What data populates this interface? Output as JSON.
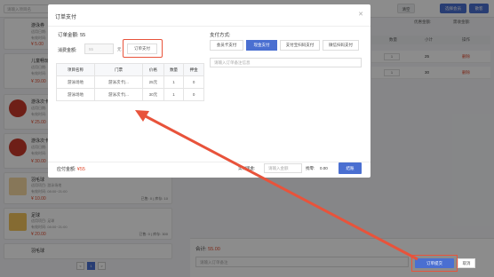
{
  "background": {
    "search_placeholder": "请输入项目名",
    "top_buttons": [
      "清空",
      "选择会员",
      "散客"
    ],
    "summary": {
      "discount_label": "优惠金额:",
      "received_label": "需收金额:"
    },
    "cards": [
      {
        "name": "游泳券",
        "line1": "适用日期:",
        "line2": "有效时间:",
        "price": "¥ 5.00"
      },
      {
        "name": "儿童畅玩",
        "line1": "适用日期:",
        "line2": "有效时间:",
        "price": "¥ 39.00"
      },
      {
        "name": "游泳次卡",
        "line1": "适用日期:",
        "line2": "有效时间:",
        "price": "¥ 25.00"
      },
      {
        "name": "游泳次卡",
        "line1": "适用日期:",
        "line2": "有效时间:",
        "price": "¥ 30.00"
      },
      {
        "name": "羽毛球",
        "line1": "适用项目: 游泳场地",
        "line2": "有效时间: 08:00~21:00",
        "price": "¥ 10.00",
        "meta": "已售: 0 | 库存: 10"
      },
      {
        "name": "足球",
        "line1": "适用项目: 足球",
        "line2": "有效时间: 08:00~21:00",
        "price": "¥ 20.00",
        "meta": "已售: 0 | 库存: 300"
      },
      {
        "name": "羽毛球",
        "line1": "",
        "line2": "",
        "price": ""
      }
    ],
    "cart_headers": [
      "数量",
      "小计",
      "操作"
    ],
    "cart_rows": [
      {
        "qty": "1",
        "subtotal": "25",
        "action": "删除"
      },
      {
        "qty": "1",
        "subtotal": "30",
        "action": "删除"
      }
    ],
    "total_label": "合计:",
    "total_value": "55.00",
    "remark_placeholder": "请输入订单备注",
    "submit_button": "订单提交",
    "cancel_button": "取消",
    "pager": [
      "<",
      "1",
      ">"
    ]
  },
  "modal": {
    "title": "订单支付",
    "close_icon": "close-icon",
    "amount_label": "订单金额:",
    "amount_value": "55",
    "consume_label": "消费金额:",
    "consume_placeholder": "55",
    "yuan": "元",
    "order_pay_button": "订单支付",
    "table": {
      "headers": [
        "项目名称",
        "门票",
        "价格",
        "数量",
        "押金"
      ],
      "rows": [
        [
          "游泳场地",
          "游泳次卡|...",
          "25元",
          "1",
          "0"
        ],
        [
          "游泳场地",
          "游泳次卡|...",
          "30元",
          "1",
          "0"
        ]
      ]
    },
    "pay_method_label": "支付方式:",
    "pay_methods": [
      "会员卡支付",
      "现金支付",
      "支付宝扫码支付",
      "微信扫码支付"
    ],
    "active_pay_method": "现金支付",
    "note_placeholder": "请输入订单备注信息",
    "received_label": "应付金额:",
    "received_value": "¥55",
    "cash_label": "实付现金:",
    "cash_placeholder": "请输入金额",
    "change_label": "找零:",
    "change_value": "0.00",
    "confirm_button": "结账"
  },
  "colors": {
    "accent": "#4a6fd1",
    "highlight": "#e8533b",
    "price": "#e04c2f"
  }
}
